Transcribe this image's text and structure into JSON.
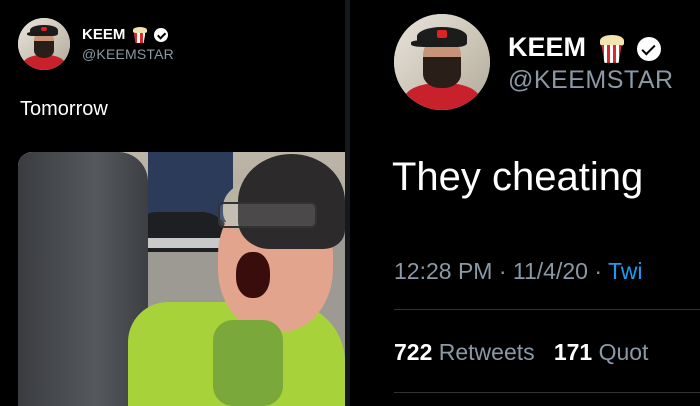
{
  "left_tweet": {
    "display_name": "KEEM",
    "handle": "@KEEMSTAR",
    "text": "Tomorrow",
    "badge_icon": "popcorn-icon",
    "verified_icon": "verified-badge-icon",
    "media_description_icon": "crying-person-photo"
  },
  "right_tweet": {
    "display_name": "KEEM",
    "handle": "@KEEMSTAR",
    "text": "They cheating",
    "time": "12:28 PM",
    "separator": " · ",
    "date": "11/4/20",
    "source": "Twi",
    "retweets_count": "722",
    "retweets_label": "Retweets",
    "quotes_count": "171",
    "quotes_label": "Quot",
    "badge_icon": "popcorn-icon",
    "verified_icon": "verified-badge-icon"
  },
  "colors": {
    "background": "#000000",
    "secondary_text": "#8b98a5",
    "link": "#1d9bf0",
    "divider": "#2f3336"
  }
}
